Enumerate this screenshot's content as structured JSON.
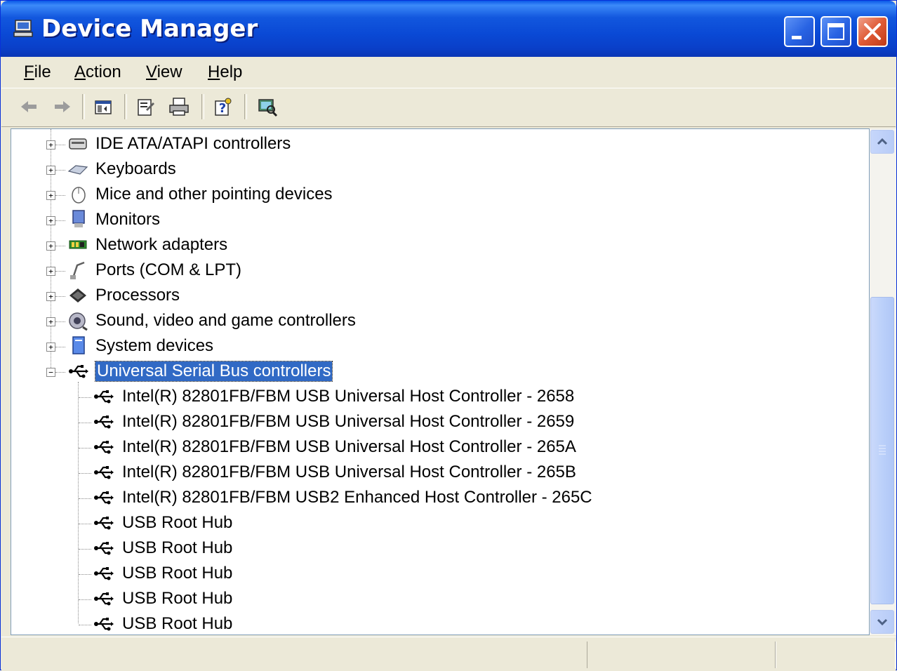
{
  "window": {
    "title": "Device Manager",
    "controls": {
      "minimize": "minimize",
      "maximize": "maximize",
      "close": "close"
    }
  },
  "menu": [
    {
      "label": "File",
      "mnemonic": "F",
      "rest": "ile"
    },
    {
      "label": "Action",
      "mnemonic": "A",
      "rest": "ction"
    },
    {
      "label": "View",
      "mnemonic": "V",
      "rest": "iew"
    },
    {
      "label": "Help",
      "mnemonic": "H",
      "rest": "elp"
    }
  ],
  "toolbar": {
    "buttons": [
      "back-icon",
      "forward-icon",
      "show-hide-console-tree-icon",
      "properties-icon",
      "print-icon",
      "help-icon",
      "scan-hardware-icon"
    ],
    "back_enabled": false,
    "forward_enabled": false
  },
  "tree": {
    "categories": [
      {
        "label": "IDE ATA/ATAPI controllers",
        "icon": "ide-controller-icon",
        "expanded": false
      },
      {
        "label": "Keyboards",
        "icon": "keyboard-icon",
        "expanded": false
      },
      {
        "label": "Mice and other pointing devices",
        "icon": "mouse-icon",
        "expanded": false
      },
      {
        "label": "Monitors",
        "icon": "monitor-icon",
        "expanded": false
      },
      {
        "label": "Network adapters",
        "icon": "network-adapter-icon",
        "expanded": false
      },
      {
        "label": "Ports (COM & LPT)",
        "icon": "port-icon",
        "expanded": false
      },
      {
        "label": "Processors",
        "icon": "processor-icon",
        "expanded": false
      },
      {
        "label": "Sound, video and game controllers",
        "icon": "sound-icon",
        "expanded": false
      },
      {
        "label": "System devices",
        "icon": "system-device-icon",
        "expanded": false
      },
      {
        "label": "Universal Serial Bus controllers",
        "icon": "usb-icon",
        "expanded": true,
        "selected": true
      }
    ],
    "usb_children": [
      "Intel(R) 82801FB/FBM USB Universal Host Controller - 2658",
      "Intel(R) 82801FB/FBM USB Universal Host Controller - 2659",
      "Intel(R) 82801FB/FBM USB Universal Host Controller - 265A",
      "Intel(R) 82801FB/FBM USB Universal Host Controller - 265B",
      "Intel(R) 82801FB/FBM USB2 Enhanced Host Controller - 265C",
      "USB Root Hub",
      "USB Root Hub",
      "USB Root Hub",
      "USB Root Hub",
      "USB Root Hub"
    ]
  },
  "colors": {
    "titlebar": "#0A49D5",
    "selection": "#316AC5",
    "chrome": "#ECE9D8",
    "close_button": "#DF5B36"
  }
}
